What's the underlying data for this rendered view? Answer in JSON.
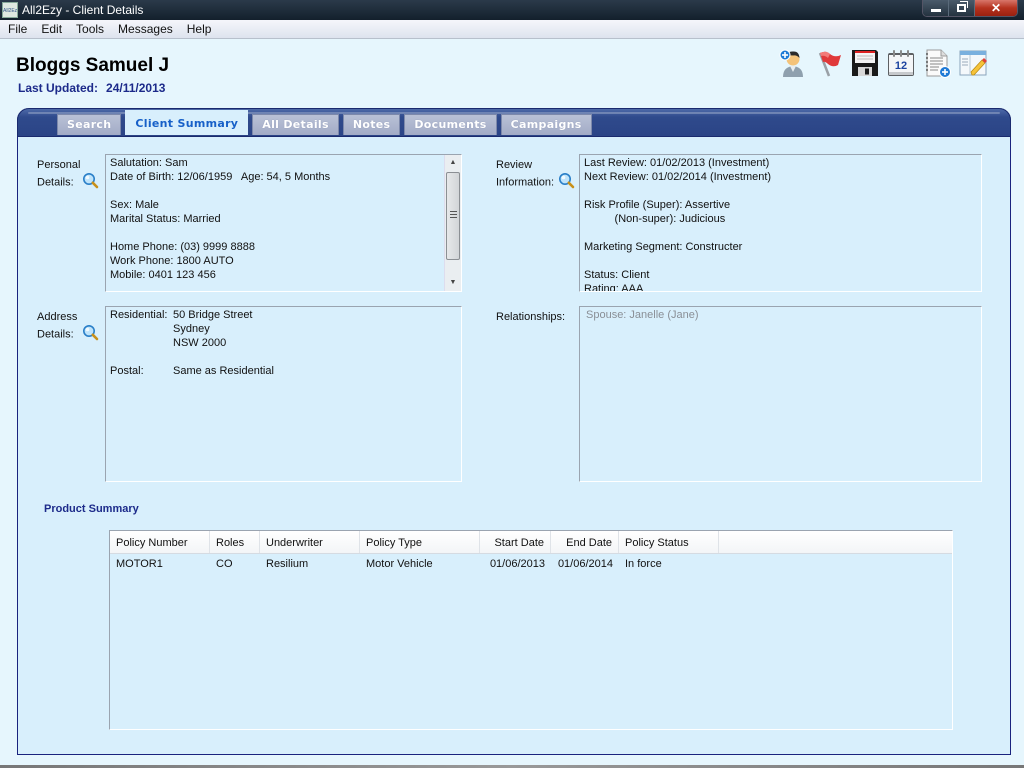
{
  "window": {
    "title": "All2Ezy - Client Details",
    "app_icon_text": "All2Ezy"
  },
  "menu": [
    "File",
    "Edit",
    "Tools",
    "Messages",
    "Help"
  ],
  "header": {
    "client_name": "Bloggs Samuel J",
    "last_updated_label": "Last Updated:",
    "last_updated_value": "24/11/2013"
  },
  "toolbar": [
    {
      "icon": "add-user-icon",
      "name": "add-contact-button"
    },
    {
      "icon": "flag-icon",
      "name": "flag-button"
    },
    {
      "icon": "save-icon",
      "name": "save-button"
    },
    {
      "icon": "calendar-icon",
      "name": "calendar-button",
      "text": "12"
    },
    {
      "icon": "new-document-icon",
      "name": "new-document-button"
    },
    {
      "icon": "edit-form-icon",
      "name": "edit-button"
    }
  ],
  "tabs": [
    {
      "label": "Search",
      "active": false
    },
    {
      "label": "Client Summary",
      "active": true
    },
    {
      "label": "All Details",
      "active": false
    },
    {
      "label": "Notes",
      "active": false
    },
    {
      "label": "Documents",
      "active": false
    },
    {
      "label": "Campaigns",
      "active": false
    }
  ],
  "personal": {
    "label_line1": "Personal",
    "label_line2": "Details:",
    "lines": [
      "Salutation: Sam",
      "Date of Birth: 12/06/1959   Age: 54, 5 Months",
      "",
      "Sex: Male",
      "Marital Status: Married",
      "",
      "Home Phone: (03) 9999 8888",
      "Work Phone: 1800 AUTO",
      "Mobile: 0401 123 456"
    ]
  },
  "review": {
    "label_line1": "Review",
    "label_line2": "Information:",
    "lines": [
      "Last Review: 01/02/2013 (Investment)",
      "Next Review: 01/02/2014 (Investment)",
      "",
      "Risk Profile (Super): Assertive",
      "          (Non-super): Judicious",
      "",
      "Marketing Segment: Constructer",
      "",
      "Status: Client",
      "Rating: AAA"
    ]
  },
  "address": {
    "label_line1": "Address",
    "label_line2": "Details:",
    "residential_label": "Residential:",
    "residential_lines": [
      "50 Bridge Street",
      "Sydney",
      "NSW 2000"
    ],
    "postal_label": "Postal:",
    "postal_value": "Same as Residential"
  },
  "relationships": {
    "label": "Relationships:",
    "items": [
      "Spouse: Janelle (Jane)"
    ]
  },
  "products": {
    "title": "Product Summary",
    "columns": [
      "Policy Number",
      "Roles",
      "Underwriter",
      "Policy Type",
      "Start Date",
      "End Date",
      "Policy Status",
      ""
    ],
    "rows": [
      [
        "MOTOR1",
        "CO",
        "Resilium",
        "Motor Vehicle",
        "01/06/2013",
        "01/06/2014",
        "In force",
        ""
      ]
    ]
  },
  "colors": {
    "accent_dark_blue": "#1c2a8a",
    "active_tab_text": "#1760c8",
    "tab_strip": "#2f4a8c",
    "panel_bg": "#d8effc",
    "window_bg": "#e6f6fd"
  }
}
